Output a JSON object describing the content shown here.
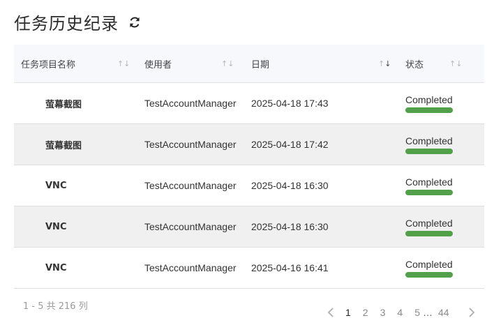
{
  "header": {
    "title": "任务历史纪录"
  },
  "table": {
    "columns": [
      "任务项目名称",
      "使用者",
      "日期",
      "状态"
    ],
    "sort_neutral": "↑↓",
    "sort_up": "↑",
    "sort_down": "↓",
    "rows": [
      {
        "name": "萤幕截图",
        "user": "TestAccountManager",
        "date": "2025-04-18 17:43",
        "status": "Completed",
        "progress": 1.0
      },
      {
        "name": "萤幕截图",
        "user": "TestAccountManager",
        "date": "2025-04-18 17:42",
        "status": "Completed",
        "progress": 1.0
      },
      {
        "name": "VNC",
        "user": "TestAccountManager",
        "date": "2025-04-18 16:30",
        "status": "Completed",
        "progress": 1.0
      },
      {
        "name": "VNC",
        "user": "TestAccountManager",
        "date": "2025-04-18 16:30",
        "status": "Completed",
        "progress": 1.0
      },
      {
        "name": "VNC",
        "user": "TestAccountManager",
        "date": "2025-04-16 16:41",
        "status": "Completed",
        "progress": 1.0
      }
    ]
  },
  "footer": {
    "count_text": "1 - 5 共 216 列",
    "pages": [
      "1",
      "2",
      "3",
      "4",
      "5"
    ],
    "ellipsis": "…",
    "last_page": "44",
    "current_page": "1"
  },
  "colors": {
    "status_completed": "#52a049",
    "header_bg": "#f7f8fc",
    "alt_row_bg": "#f0f0f0"
  },
  "icons": {
    "refresh": "refresh-icon",
    "prev": "chevron-left-icon",
    "next": "chevron-right-icon"
  }
}
